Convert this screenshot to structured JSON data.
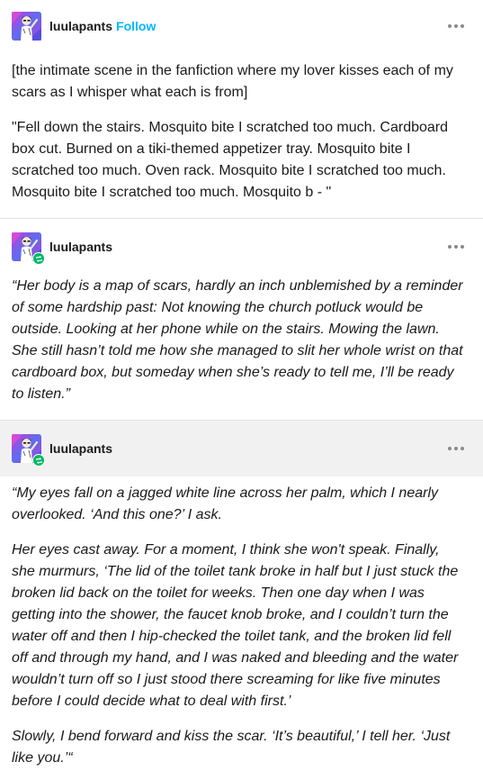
{
  "posts": [
    {
      "username": "luulapants",
      "follow_label": "Follow",
      "paragraphs": [
        "[the intimate scene in the fanfiction where my lover kisses each of my scars as I whisper what each is from]",
        "\"Fell down the stairs. Mosquito bite I scratched too much. Cardboard box cut. Burned on a tiki-themed appetizer tray. Mosquito bite I scratched too much. Oven rack. Mosquito bite I scratched too much. Mosquito bite I scratched too much. Mosquito b - \""
      ]
    },
    {
      "username": "luulapants",
      "paragraphs": [
        "“Her body is a map of scars, hardly an inch unblemished by a reminder of some hardship past: Not knowing the church potluck would be outside. Looking at her phone while on the stairs. Mowing the lawn. She still hasn’t told me how she managed to slit her whole wrist on that cardboard box, but someday when she’s ready to tell me, I’ll be ready to listen.”"
      ]
    },
    {
      "username": "luulapants",
      "paragraphs": [
        "“My eyes fall on a jagged white line across her palm, which I nearly overlooked. ‘And this one?’ I ask.",
        "Her eyes cast away. For a moment, I think she won't speak. Finally, she murmurs, ‘The lid of the toilet tank broke in half but I just stuck the broken lid back on the toilet for weeks. Then one day when I was getting into the shower, the faucet knob broke, and I couldn’t turn the water off and then I hip-checked the toilet tank, and the broken lid fell off and through my hand, and I was naked and bleeding and the water wouldn’t turn off so I just stood there screaming for like five minutes before I could decide what to deal with first.’",
        "Slowly, I bend forward and kiss the scar. ‘It’s beautiful,’ I tell her. ‘Just like you.’“"
      ]
    }
  ],
  "icons": {
    "more": "more-options-icon",
    "reblog": "reblog-icon",
    "avatar": "user-avatar"
  },
  "colors": {
    "follow": "#00b8ff",
    "reblog_badge": "#00b865",
    "highlight_header": "#f1f1f1"
  }
}
